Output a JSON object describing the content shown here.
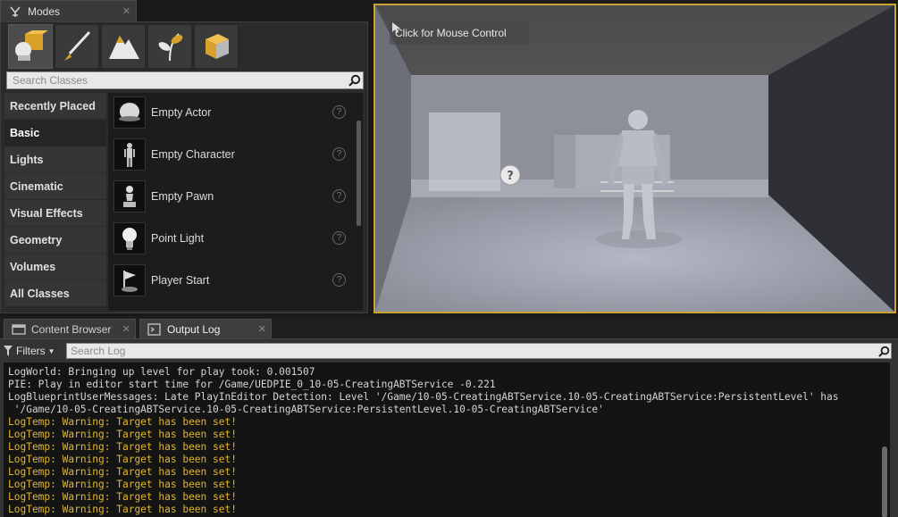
{
  "modes": {
    "tab_label": "Modes",
    "search_placeholder": "Search Classes",
    "categories": [
      {
        "label": "Recently Placed"
      },
      {
        "label": "Basic"
      },
      {
        "label": "Lights"
      },
      {
        "label": "Cinematic"
      },
      {
        "label": "Visual Effects"
      },
      {
        "label": "Geometry"
      },
      {
        "label": "Volumes"
      },
      {
        "label": "All Classes"
      }
    ],
    "active_category": "Basic",
    "mode_buttons": [
      {
        "icon": "place-mode-icon"
      },
      {
        "icon": "paint-mode-icon"
      },
      {
        "icon": "landscape-mode-icon"
      },
      {
        "icon": "foliage-mode-icon"
      },
      {
        "icon": "geometry-edit-mode-icon"
      }
    ],
    "items": [
      {
        "label": "Empty Actor",
        "icon": "sphere-icon"
      },
      {
        "label": "Empty Character",
        "icon": "character-icon"
      },
      {
        "label": "Empty Pawn",
        "icon": "pawn-icon"
      },
      {
        "label": "Point Light",
        "icon": "lightbulb-icon"
      },
      {
        "label": "Player Start",
        "icon": "flag-icon"
      }
    ]
  },
  "viewport": {
    "overlay_text": "Click for Mouse Control",
    "border_color": "#c9a430"
  },
  "bottom_tabs": [
    {
      "label": "Content Browser",
      "icon": "content-browser-icon"
    },
    {
      "label": "Output Log",
      "icon": "output-log-icon"
    }
  ],
  "output_log": {
    "filters_label": "Filters",
    "search_placeholder": "Search Log",
    "lines": [
      {
        "text": "LogWorld: Bringing up level for play took: 0.001507",
        "level": "info"
      },
      {
        "text": "PIE: Play in editor start time for /Game/UEDPIE_0_10-05-CreatingABTService -0.221",
        "level": "info"
      },
      {
        "text": "LogBlueprintUserMessages: Late PlayInEditor Detection: Level '/Game/10-05-CreatingABTService.10-05-CreatingABTService:PersistentLevel' has",
        "level": "info"
      },
      {
        "text": " '/Game/10-05-CreatingABTService.10-05-CreatingABTService:PersistentLevel.10-05-CreatingABTService'",
        "level": "info"
      },
      {
        "text": "LogTemp: Warning: Target has been set!",
        "level": "warning"
      },
      {
        "text": "LogTemp: Warning: Target has been set!",
        "level": "warning"
      },
      {
        "text": "LogTemp: Warning: Target has been set!",
        "level": "warning"
      },
      {
        "text": "LogTemp: Warning: Target has been set!",
        "level": "warning"
      },
      {
        "text": "LogTemp: Warning: Target has been set!",
        "level": "warning"
      },
      {
        "text": "LogTemp: Warning: Target has been set!",
        "level": "warning"
      },
      {
        "text": "LogTemp: Warning: Target has been set!",
        "level": "warning"
      },
      {
        "text": "LogTemp: Warning: Target has been set!",
        "level": "warning"
      }
    ],
    "warning_color": "#e0b530",
    "info_color": "#d4d4d4"
  }
}
